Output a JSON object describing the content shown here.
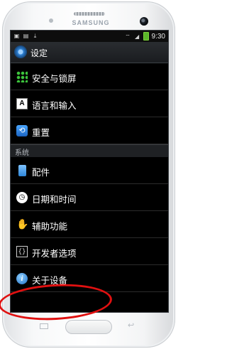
{
  "device": {
    "brand": "SAMSUNG"
  },
  "status_bar": {
    "time": "9:30"
  },
  "header": {
    "title": "设定"
  },
  "items_top": [
    {
      "label": "安全与锁屏",
      "icon": "security-grid-icon"
    },
    {
      "label": "语言和输入",
      "icon": "language-input-icon"
    },
    {
      "label": "重置",
      "icon": "reset-icon"
    }
  ],
  "section_header": "系统",
  "items_system": [
    {
      "label": "配件",
      "icon": "accessory-icon"
    },
    {
      "label": "日期和时间",
      "icon": "clock-icon"
    },
    {
      "label": "辅助功能",
      "icon": "accessibility-hand-icon"
    },
    {
      "label": "开发者选项",
      "icon": "developer-options-icon"
    },
    {
      "label": "关于设备",
      "icon": "info-icon"
    }
  ],
  "colors": {
    "accent_blue": "#2f83d6",
    "highlight_red": "#e01010",
    "security_green": "#3cc33c"
  }
}
